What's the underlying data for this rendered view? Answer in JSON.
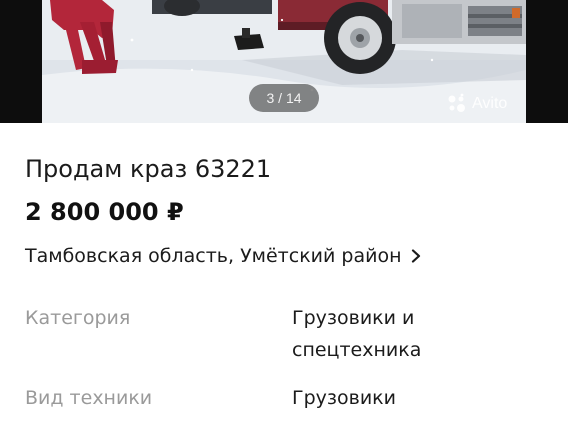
{
  "gallery": {
    "counter": "3 / 14",
    "watermark": "Avito"
  },
  "listing": {
    "title": "Продам краз 63221",
    "price": "2 800 000 ₽",
    "location": "Тамбовская область, Умётский район"
  },
  "params": [
    {
      "name": "Категория",
      "value": "Грузовики и спецтехника"
    },
    {
      "name": "Вид техники",
      "value": "Грузовики"
    }
  ],
  "icons": {
    "location_chevron": "chevron-right-icon",
    "watermark_logo": "avito-logo-icon"
  }
}
